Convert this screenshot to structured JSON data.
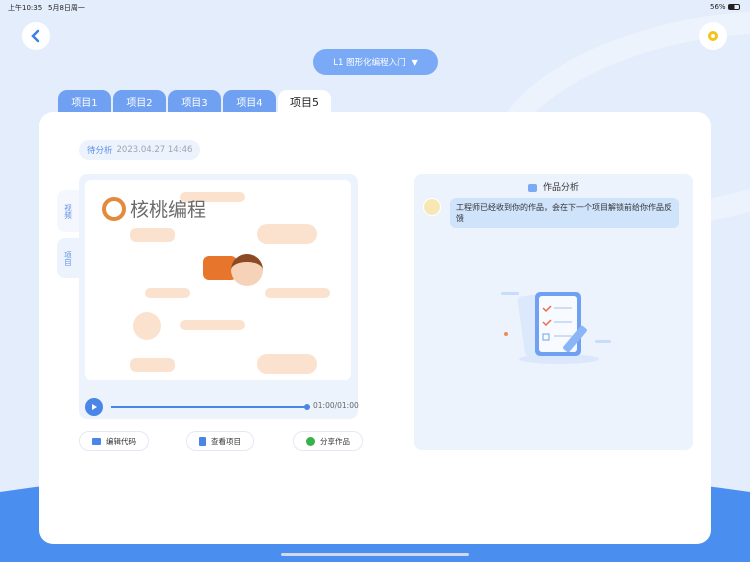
{
  "status_bar": {
    "time": "上午10:35",
    "date": "5月8日周一",
    "battery": "56%"
  },
  "header": {
    "course_selector": "L1 图形化编程入门"
  },
  "tabs": [
    {
      "label": "项目1"
    },
    {
      "label": "项目2"
    },
    {
      "label": "项目3"
    },
    {
      "label": "项目4"
    },
    {
      "label": "项目5",
      "active": true
    }
  ],
  "submission": {
    "status": "待分析",
    "datetime": "2023.04.27 14:46"
  },
  "side_tabs": {
    "video": "视频",
    "project": "项目"
  },
  "video": {
    "logo_text": "核桃编程",
    "time": "01:00/01:00",
    "progress": 1.0
  },
  "actions": {
    "edit_code": "编辑代码",
    "view_project": "查看项目",
    "share": "分享作品"
  },
  "analysis": {
    "title": "作品分析",
    "message": "工程师已经收到你的作品，会在下一个项目解锁前给你作品反馈"
  }
}
